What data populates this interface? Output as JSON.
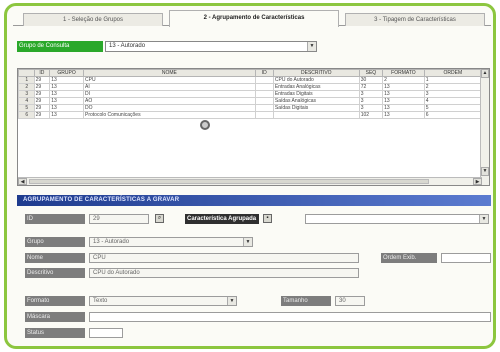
{
  "tabs": [
    {
      "label": "1 - Seleção de Grupos"
    },
    {
      "label": "2 - Agrupamento de Características"
    },
    {
      "label": "3 - Tipagem de Características"
    }
  ],
  "group_selector": {
    "label": "Grupo de Consulta",
    "value": "13 - Autorado"
  },
  "grid": {
    "columns": [
      "",
      "ID",
      "GRUPO",
      "NOME",
      "ID",
      "DESCRITIVO",
      "SEQ",
      "FORMATO",
      "ORDEM"
    ],
    "rows": [
      [
        "1",
        "29",
        "13",
        "CPU",
        "",
        "CPU do Autorado",
        "30",
        "2",
        "1"
      ],
      [
        "2",
        "29",
        "13",
        "AI",
        "",
        "Entradas Analógicas",
        "72",
        "13",
        "2"
      ],
      [
        "3",
        "29",
        "13",
        "DI",
        "",
        "Entradas Digitais",
        "3",
        "13",
        "3"
      ],
      [
        "4",
        "29",
        "13",
        "AO",
        "",
        "Saídas Analógicas",
        "3",
        "13",
        "4"
      ],
      [
        "5",
        "29",
        "13",
        "DO",
        "",
        "Saídas Digitais",
        "3",
        "13",
        "5"
      ],
      [
        "6",
        "29",
        "13",
        "Protocolo Comunicações",
        "",
        "",
        "102",
        "13",
        "6"
      ]
    ]
  },
  "section_title": "AGRUPAMENTO DE CARACTERÍSTICAS A GRAVAR",
  "form": {
    "id_label": "ID",
    "id_value": "29",
    "carac_label": "Característica Agrupada",
    "carac_value": "",
    "grupo_label": "Grupo",
    "grupo_value": "13 - Autorado",
    "nome_label": "Nome",
    "nome_value": "CPU",
    "ordem_label": "Ordem Exib.",
    "ordem_value": "",
    "descritivo_label": "Descritivo",
    "descritivo_value": "CPU do Autorado",
    "formato_label": "Formato",
    "formato_value": "Texto",
    "tamanho_label": "Tamanho",
    "tamanho_value": "30",
    "mascara_label": "Máscara",
    "mascara_value": "",
    "status_label": "Status",
    "status_value": ""
  },
  "icons": {
    "dropdown": "chevron-down-icon",
    "search": "search-icon",
    "save": "save-icon",
    "busy": "busy-cursor-icon"
  }
}
